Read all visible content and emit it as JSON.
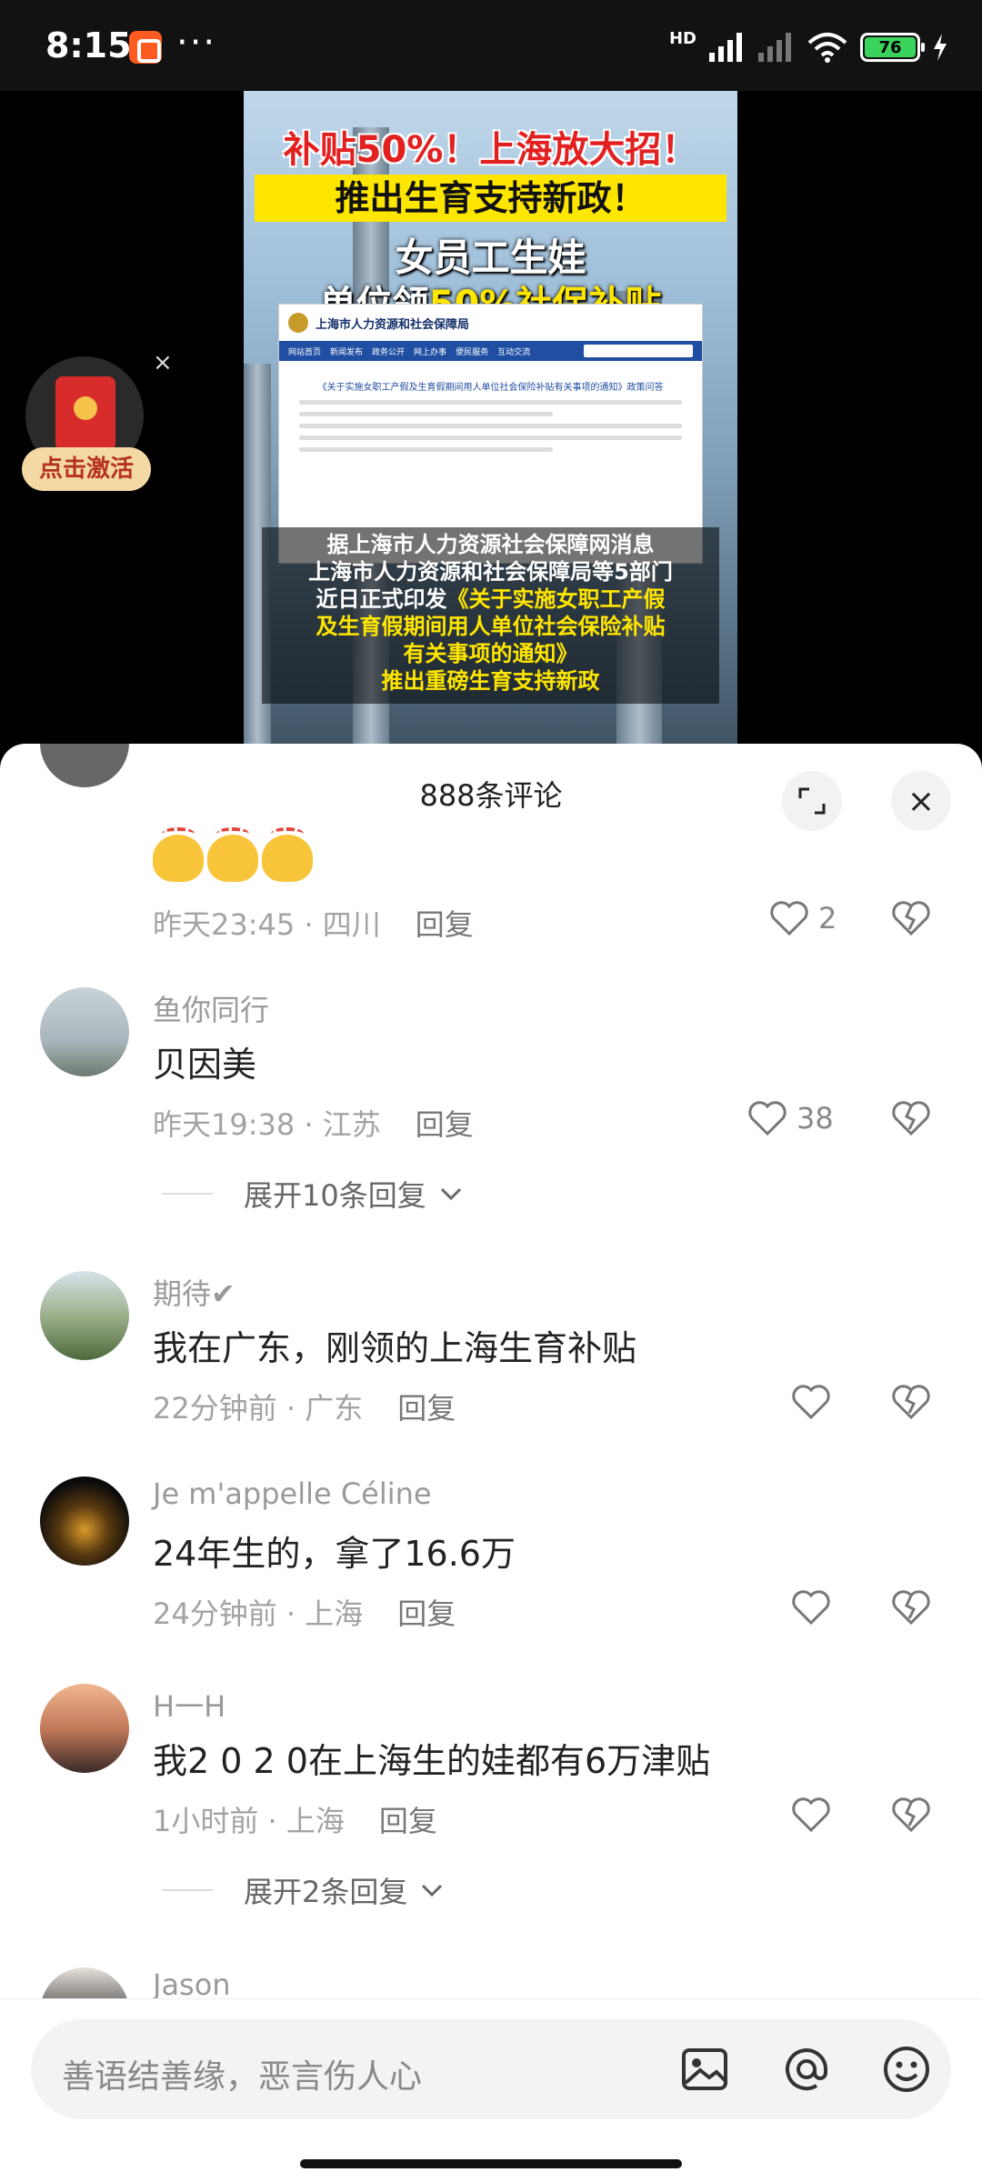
{
  "status_bar": {
    "time": "8:15",
    "more": "···",
    "network": "HD",
    "battery": "76"
  },
  "video": {
    "headline1": "补贴50%！上海放大招！",
    "headline2": "推出生育支持新政！",
    "headline3": "女员工生娃",
    "headline4_prefix": "单位领",
    "headline4_highlight": "50%社保补贴",
    "doc_site": "上海市人力资源和社会保障局",
    "doc_nav": [
      "网站首页",
      "新闻发布",
      "政务公开",
      "网上办事",
      "便民服务",
      "互动交流"
    ],
    "doc_heading": "《关于实施女职工产假及生育假期间用人单位社会保险补贴有关事项的通知》政策问答",
    "caption_lines": [
      "据上海市人力资源社会保障网消息",
      "上海市人力资源和社会保障局等5部门"
    ],
    "caption_line3_prefix": "近日正式印发",
    "caption_line3_highlight": "《关于实施女职工产假",
    "caption_line4": "及生育假期间用人单位社会保险补贴",
    "caption_line5": "有关事项的通知》",
    "caption_line6": "推出重磅生育支持新政"
  },
  "promo": {
    "label": "点击激活",
    "close": "×"
  },
  "comments_sheet": {
    "title": "888条评论",
    "close": "×",
    "reply_label": "回复",
    "comments": [
      {
        "name": "",
        "text": "",
        "time": "昨天23:45",
        "location": "四川",
        "likes": "2"
      },
      {
        "name": "鱼你同行",
        "text": "贝因美",
        "time": "昨天19:38",
        "location": "江苏",
        "likes": "38",
        "expand": "展开10条回复"
      },
      {
        "name": "期待✔",
        "text": "我在广东，刚领的上海生育补贴",
        "time": "22分钟前",
        "location": "广东",
        "likes": ""
      },
      {
        "name": "Je m'appelle Céline",
        "text": "24年生的，拿了16.6万",
        "time": "24分钟前",
        "location": "上海",
        "likes": ""
      },
      {
        "name": "H一H",
        "text": "我2 0 2 0在上海生的娃都有6万津贴",
        "time": "1小时前",
        "location": "上海",
        "likes": "",
        "expand": "展开2条回复"
      },
      {
        "name": "Jason",
        "text": "",
        "time": "",
        "location": "",
        "likes": ""
      }
    ]
  },
  "input_bar": {
    "placeholder": "善语结善缘，恶言伤人心"
  },
  "colors": {
    "accent_red": "#e32020",
    "highlight_yellow": "#ffe600",
    "battery_green": "#3ad35c"
  }
}
